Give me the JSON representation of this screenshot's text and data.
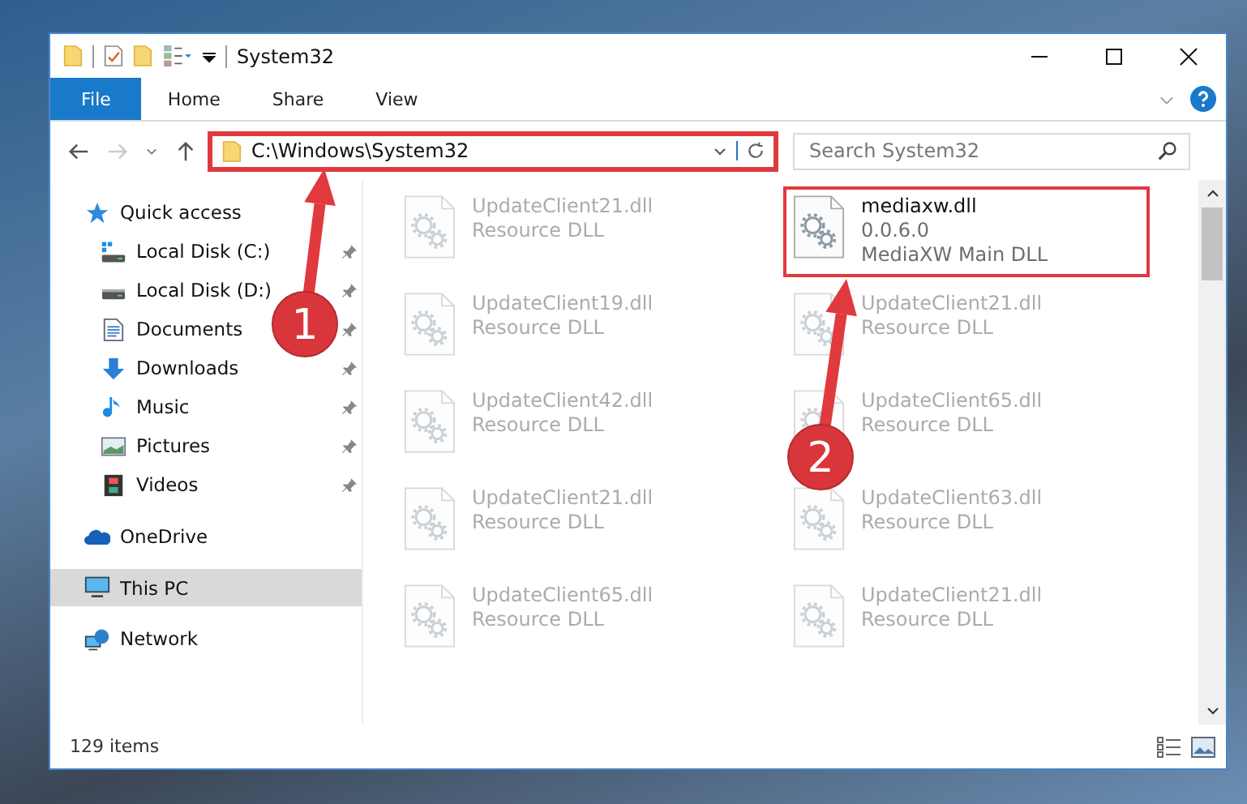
{
  "window": {
    "title": "System32"
  },
  "ribbon": {
    "tabs": [
      {
        "label": "File",
        "kind": "file-menu"
      },
      {
        "label": "Home",
        "kind": "tab"
      },
      {
        "label": "Share",
        "kind": "tab"
      },
      {
        "label": "View",
        "kind": "tab"
      }
    ]
  },
  "address_bar": {
    "path": "C:\\Windows\\System32",
    "highlighted": true
  },
  "search": {
    "placeholder": "Search System32"
  },
  "navigation": {
    "items": [
      {
        "label": "Quick access",
        "kind": "quick-access",
        "selected": false,
        "children": [
          {
            "label": "Local Disk (C:)",
            "kind": "system-drive",
            "pinned": true,
            "selected": false
          },
          {
            "label": "Local Disk (D:)",
            "kind": "drive",
            "pinned": true,
            "selected": false
          },
          {
            "label": "Documents",
            "kind": "documents",
            "pinned": true,
            "selected": false
          },
          {
            "label": "Downloads",
            "kind": "downloads",
            "pinned": true,
            "selected": false
          },
          {
            "label": "Music",
            "kind": "music",
            "pinned": true,
            "selected": false
          },
          {
            "label": "Pictures",
            "kind": "pictures",
            "pinned": true,
            "selected": false
          },
          {
            "label": "Videos",
            "kind": "videos",
            "pinned": true,
            "selected": false
          }
        ]
      },
      {
        "label": "OneDrive",
        "kind": "cloud",
        "selected": false
      },
      {
        "label": "This PC",
        "kind": "computer",
        "selected": true
      },
      {
        "label": "Network",
        "kind": "network",
        "selected": false
      }
    ]
  },
  "files": [
    {
      "name": "UpdateClient21.dll",
      "details": [
        "Resource DLL"
      ],
      "blurred": true,
      "highlighted": false
    },
    {
      "name": "mediaxw.dll",
      "details": [
        "0.0.6.0",
        "MediaXW Main DLL"
      ],
      "blurred": false,
      "highlighted": true
    },
    {
      "name": "UpdateClient19.dll",
      "details": [
        "Resource DLL"
      ],
      "blurred": true,
      "highlighted": false
    },
    {
      "name": "UpdateClient21.dll",
      "details": [
        "Resource DLL"
      ],
      "blurred": true,
      "highlighted": false
    },
    {
      "name": "UpdateClient42.dll",
      "details": [
        "Resource DLL"
      ],
      "blurred": true,
      "highlighted": false
    },
    {
      "name": "UpdateClient65.dll",
      "details": [
        "Resource DLL"
      ],
      "blurred": true,
      "highlighted": false
    },
    {
      "name": "UpdateClient21.dll",
      "details": [
        "Resource DLL"
      ],
      "blurred": true,
      "highlighted": false
    },
    {
      "name": "UpdateClient63.dll",
      "details": [
        "Resource DLL"
      ],
      "blurred": true,
      "highlighted": false
    },
    {
      "name": "UpdateClient65.dll",
      "details": [
        "Resource DLL"
      ],
      "blurred": true,
      "highlighted": false
    },
    {
      "name": "UpdateClient21.dll",
      "details": [
        "Resource DLL"
      ],
      "blurred": true,
      "highlighted": false
    }
  ],
  "status_bar": {
    "count": "129 items"
  },
  "annotations": [
    {
      "number": "1"
    },
    {
      "number": "2"
    }
  ]
}
